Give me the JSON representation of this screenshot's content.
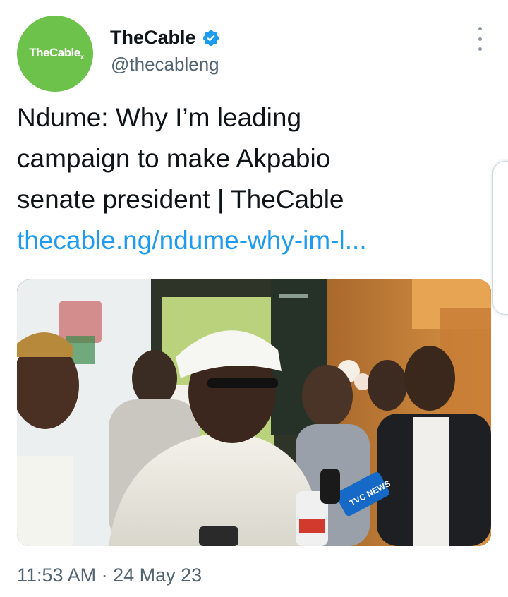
{
  "account": {
    "display_name": "TheCable",
    "handle": "@thecableng",
    "avatar_text": "TheCable",
    "avatar_mark": "x",
    "verified": true,
    "verified_icon": "verified-badge-icon",
    "brand_color": "#6cc24a"
  },
  "tweet": {
    "text_lines": [
      "Ndume: Why I’m leading",
      "campaign to make Akpabio",
      "senate president | TheCable"
    ],
    "link_text": "thecable.ng/ndume-why-im-l...",
    "media_icon": "news-photo",
    "microphone_label": "TVC NEWS",
    "timestamp": "11:53 AM · 24 May 23"
  },
  "colors": {
    "link": "#1d9bf0",
    "secondary_text": "#536471",
    "verified": "#1d9bf0"
  }
}
